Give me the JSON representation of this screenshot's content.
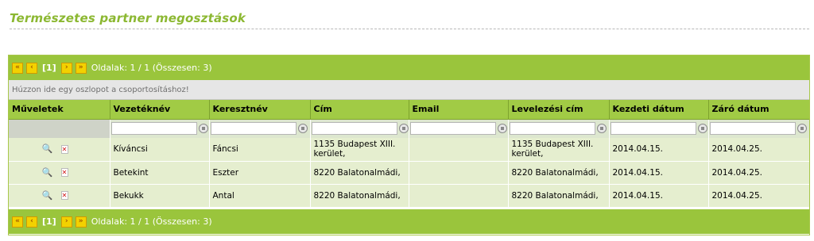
{
  "page": {
    "title": "Természetes partner megosztások"
  },
  "pager": {
    "first": "«",
    "prev": "‹",
    "current": "[1]",
    "next": "›",
    "last": "»",
    "info": "Oldalak: 1 / 1 (Összesen: 3)"
  },
  "group_hint": "Húzzon ide egy oszlopot a csoportosításhoz!",
  "columns": [
    "Műveletek",
    "Vezetéknév",
    "Keresztnév",
    "Cím",
    "Email",
    "Levelezési cím",
    "Kezdeti dátum",
    "Záró dátum"
  ],
  "rows": [
    {
      "vezeteknev": "Kíváncsi",
      "keresztnev": "Fáncsi",
      "cim": "1135 Budapest XIII. kerület,",
      "email": "",
      "levelezesi_cim": "1135 Budapest XIII. kerület,",
      "kezdeti": "2014.04.15.",
      "zaro": "2014.04.25."
    },
    {
      "vezeteknev": "Betekint",
      "keresztnev": "Eszter",
      "cim": "8220 Balatonalmádi,",
      "email": "",
      "levelezesi_cim": "8220 Balatonalmádi,",
      "kezdeti": "2014.04.15.",
      "zaro": "2014.04.25."
    },
    {
      "vezeteknev": "Bekukk",
      "keresztnev": "Antal",
      "cim": "8220 Balatonalmádi,",
      "email": "",
      "levelezesi_cim": "8220 Balatonalmádi,",
      "kezdeti": "2014.04.15.",
      "zaro": "2014.04.25."
    }
  ],
  "icons": {
    "view": "magnifier-icon",
    "delete": "delete-icon",
    "filter": "filter-icon"
  },
  "colors": {
    "accent": "#9ac53c",
    "header": "#a1cb45",
    "row": "#e5eecf",
    "title": "#8cb832"
  }
}
